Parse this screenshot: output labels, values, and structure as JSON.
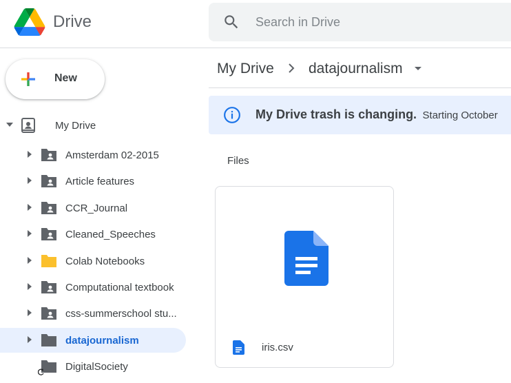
{
  "app": {
    "title": "Drive"
  },
  "search": {
    "placeholder": "Search in Drive"
  },
  "new_button": {
    "label": "New"
  },
  "sidebar": {
    "root_label": "My Drive",
    "folders": [
      {
        "label": "Amsterdam 02-2015",
        "icon": "shared-folder-icon"
      },
      {
        "label": "Article features",
        "icon": "shared-folder-icon"
      },
      {
        "label": "CCR_Journal",
        "icon": "shared-folder-icon"
      },
      {
        "label": "Cleaned_Speeches",
        "icon": "shared-folder-icon"
      },
      {
        "label": "Colab Notebooks",
        "icon": "folder-icon",
        "color": "#fbc02d"
      },
      {
        "label": "Computational textbook",
        "icon": "shared-folder-icon"
      },
      {
        "label": "css-summerschool stu...",
        "icon": "shared-folder-icon"
      },
      {
        "label": "datajournalism",
        "icon": "folder-icon",
        "active": true
      },
      {
        "label": "DigitalSociety",
        "icon": "folder-icon"
      }
    ]
  },
  "breadcrumb": {
    "root": "My Drive",
    "current": "datajournalism"
  },
  "banner": {
    "title": "My Drive trash is changing.",
    "subtitle": "Starting October"
  },
  "files_section": {
    "label": "Files"
  },
  "files": [
    {
      "name": "iris.csv",
      "icon": "docs-icon"
    }
  ],
  "colors": {
    "accent_blue": "#1a73e8",
    "active_bg": "#e8f0fe",
    "folder_gray": "#5f6368",
    "folder_yellow": "#fbc02d"
  }
}
